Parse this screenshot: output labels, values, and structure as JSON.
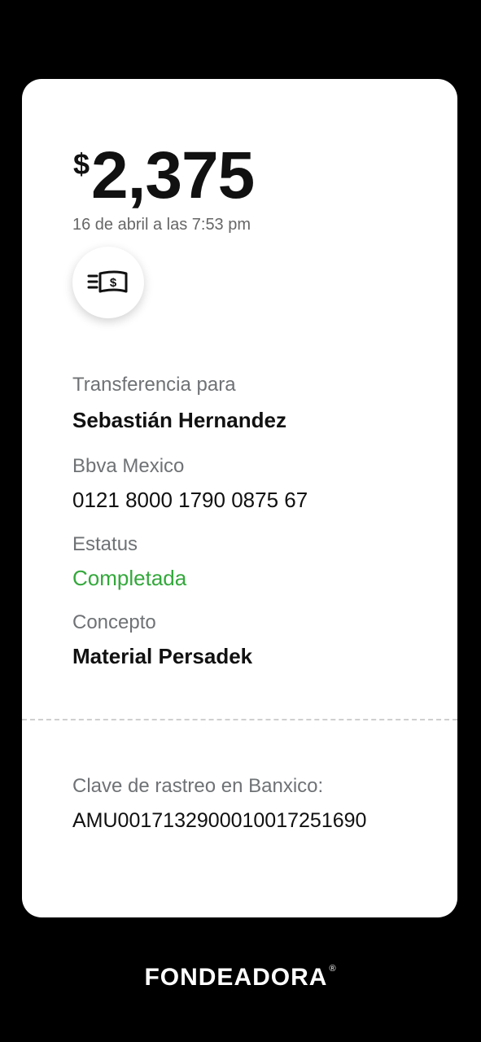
{
  "transaction": {
    "currency_symbol": "$",
    "amount": "2,375",
    "timestamp": "16 de abril a las 7:53 pm",
    "icon": "cash-transfer-icon"
  },
  "details": {
    "recipient_label": "Transferencia para",
    "recipient_name": "Sebastián Hernandez",
    "bank_label": "Bbva Mexico",
    "account_number": "0121 8000 1790 0875 67",
    "status_label": "Estatus",
    "status_value": "Completada",
    "concept_label": "Concepto",
    "concept_value": "Material Persadek"
  },
  "tracking": {
    "label": "Clave de rastreo en Banxico:",
    "value": "AMU0017132900010017251690"
  },
  "brand": {
    "name": "FONDEADORA",
    "registered_mark": "®"
  },
  "colors": {
    "status_completed": "#33a83b",
    "label_gray": "#6f7275",
    "background": "#000000",
    "card": "#ffffff"
  }
}
